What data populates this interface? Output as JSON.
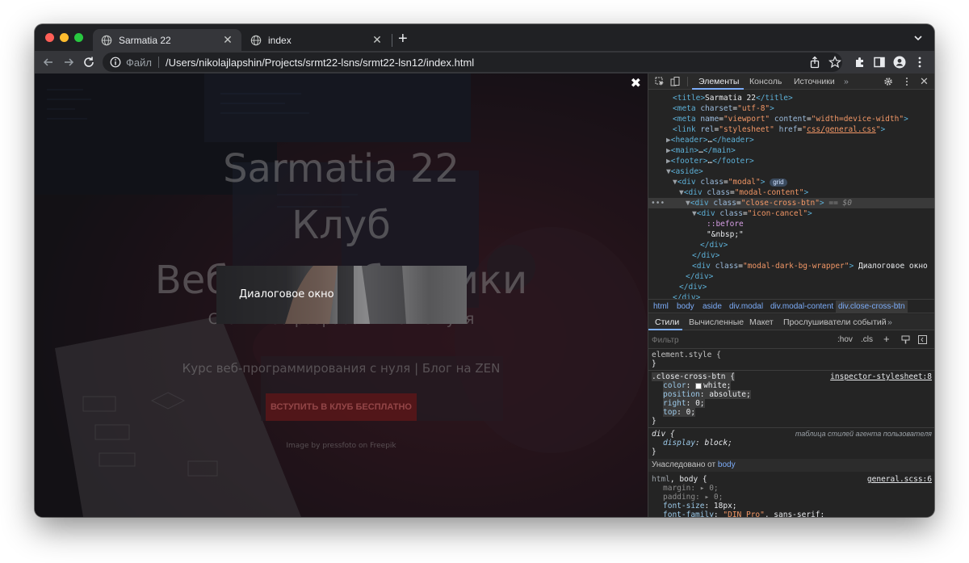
{
  "browser": {
    "tabs": [
      {
        "title": "Sarmatia 22",
        "active": true
      },
      {
        "title": "index",
        "active": false
      }
    ],
    "address": {
      "protocol_label": "Файл",
      "url": "/Users/nikolajlapshin/Projects/srmt22-lsns/srmt22-lsn12/index.html"
    }
  },
  "page": {
    "hero_title_1": "Sarmatia 22",
    "hero_title_2": "Клуб",
    "hero_title_3": "Веб-разработчики",
    "hero_subtitle": "Стань веб-разработчиком с нуля",
    "hero_tagline": "Курс веб-программирования с нуля | Блог на ZEN",
    "cta_label": "ВСТУПИТЬ В КЛУБ БЕСПЛАТНО",
    "credit": "Image by pressfoto on Freepik",
    "modal_text": "Диалоговое окно",
    "close_glyph": "✖"
  },
  "devtools": {
    "tabs": [
      "Элементы",
      "Консоль",
      "Источники"
    ],
    "more": "»",
    "breadcrumbs": [
      "html",
      "body",
      "aside",
      "div.modal",
      "div.modal-content",
      "div.close-cross-btn"
    ],
    "style_tabs": [
      "Стили",
      "Вычисленные",
      "Макет",
      "Прослушиватели событий"
    ],
    "filter_placeholder": "Фильтр",
    "filter_hov": ":hov",
    "filter_cls": ".cls",
    "inherited_label": "Унаследовано от",
    "inherited_from": "body"
  },
  "colors": {
    "window_bg": "#202124",
    "toolbar_bg": "#35363a",
    "devtools_bg": "#242424",
    "accent_blue": "#7cacf8",
    "cta_red": "#8b1a1a"
  }
}
